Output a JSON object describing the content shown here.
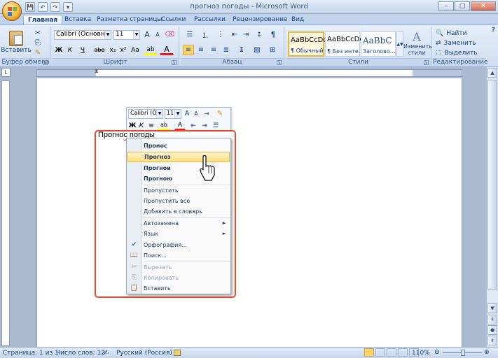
{
  "window": {
    "title": "прогноз погоды - Microsoft Word",
    "min": "–",
    "max": "□",
    "close": "✕"
  },
  "qat": {
    "save": "💾",
    "undo": "↶",
    "redo": "↷",
    "more": "▾"
  },
  "tabs": [
    "Главная",
    "Вставка",
    "Разметка страницы",
    "Ссылки",
    "Рассылки",
    "Рецензирование",
    "Вид"
  ],
  "ribbon": {
    "clipboard": {
      "paste": "Вставить",
      "label": "Буфер обмена"
    },
    "font": {
      "name": "Calibri (Основной те",
      "size": "11",
      "bold": "Ж",
      "italic": "К",
      "underline": "Ч",
      "strike": "abe",
      "sub": "x₂",
      "sup": "x²",
      "case": "Aa",
      "color": "A",
      "grow": "A",
      "shrink": "A",
      "label": "Шрифт"
    },
    "paragraph": {
      "label": "Абзац",
      "pilcrow": "¶"
    },
    "styles": {
      "items": [
        {
          "preview": "AaBbCcDc",
          "name": "¶ Обычный"
        },
        {
          "preview": "AaBbCcDc",
          "name": "¶ Без инте..."
        },
        {
          "preview": "AaBbC",
          "name": "Заголово..."
        }
      ],
      "change": "Изменить стили",
      "label": "Стили"
    },
    "editing": {
      "find": "Найти",
      "replace": "Заменить",
      "select": "Выделить",
      "label": "Редактирование"
    }
  },
  "document": {
    "before": "Прогно",
    "misspelled": "с",
    "after": " погоды"
  },
  "minitoolbar": {
    "font": "Calibri (Осн",
    "size": "11",
    "bold": "Ж",
    "italic": "К",
    "align": "≡",
    "color": "A"
  },
  "context_menu": {
    "suggestions": [
      "Пронос",
      "Прогноз",
      "Прогнои",
      "Прогною"
    ],
    "spell_actions": [
      "Пропустить",
      "Пропустить все",
      "Добавить в словарь"
    ],
    "submenus": [
      "Автозамена",
      "Язык"
    ],
    "tools": [
      "Орфография...",
      "Поиск..."
    ],
    "edit": [
      "Вырезать",
      "Копировать",
      "Вставить"
    ]
  },
  "status": {
    "page": "Страница: 1 из 1",
    "words": "Число слов: 12",
    "lang": "Русский (Россия)",
    "zoom": "110%"
  },
  "colors": {
    "accent": "#15428b",
    "highlight": "#ffdf7c",
    "redbox": "#e24a2b"
  }
}
